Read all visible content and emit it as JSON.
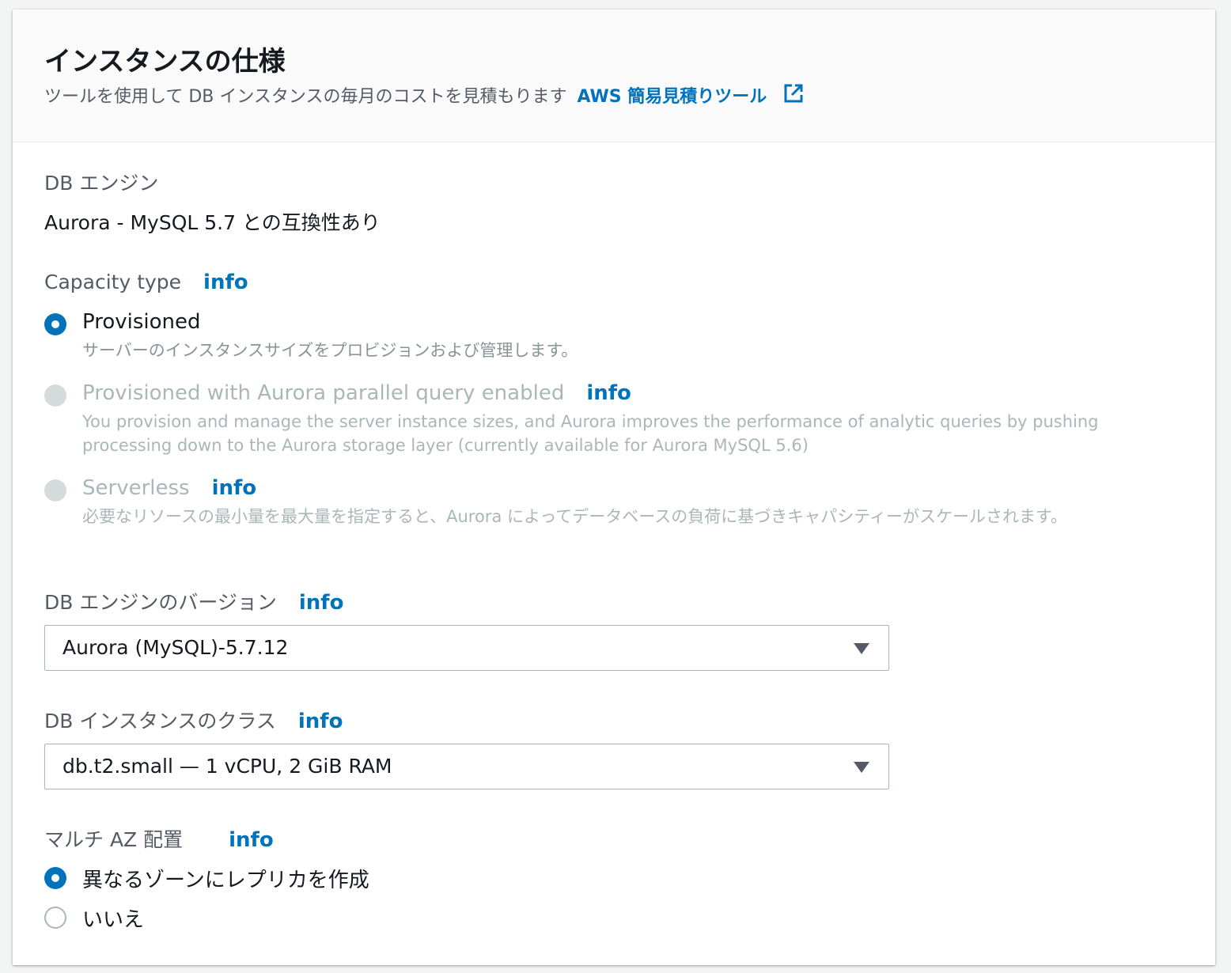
{
  "header": {
    "title": "インスタンスの仕様",
    "description": "ツールを使用して DB インスタンスの毎月のコストを見積もります",
    "link_label": "AWS 簡易見積りツール",
    "link_icon": "external-link-icon"
  },
  "engine": {
    "label": "DB エンジン",
    "value": "Aurora - MySQL 5.7 との互換性あり"
  },
  "capacity": {
    "label": "Capacity type",
    "info": "info",
    "options": [
      {
        "label": "Provisioned",
        "description": "サーバーのインスタンスサイズをプロビジョンおよび管理します。",
        "state": "selected"
      },
      {
        "label": "Provisioned with Aurora parallel query enabled",
        "info": "info",
        "description": "You provision and manage the server instance sizes, and Aurora improves the performance of analytic queries by pushing processing down to the Aurora storage layer (currently available for Aurora MySQL 5.6)",
        "state": "disabled"
      },
      {
        "label": "Serverless",
        "info": "info",
        "description": "必要なリソースの最小量を最大量を指定すると、Aurora によってデータベースの負荷に基づきキャパシティーがスケールされます。",
        "state": "disabled"
      }
    ]
  },
  "engine_version": {
    "label": "DB エンジンのバージョン",
    "info": "info",
    "selected": "Aurora (MySQL)-5.7.12"
  },
  "instance_class": {
    "label": "DB インスタンスのクラス",
    "info": "info",
    "selected": "db.t2.small — 1 vCPU, 2 GiB RAM"
  },
  "multi_az": {
    "label": "マルチ AZ 配置",
    "info": "info",
    "options": [
      {
        "label": "異なるゾーンにレプリカを作成",
        "state": "selected"
      },
      {
        "label": "いいえ",
        "state": "unselected"
      }
    ]
  },
  "colors": {
    "accent": "#0073bb",
    "text": "#16191f",
    "secondary_text": "#545b64",
    "disabled_text": "#aab7b8"
  }
}
